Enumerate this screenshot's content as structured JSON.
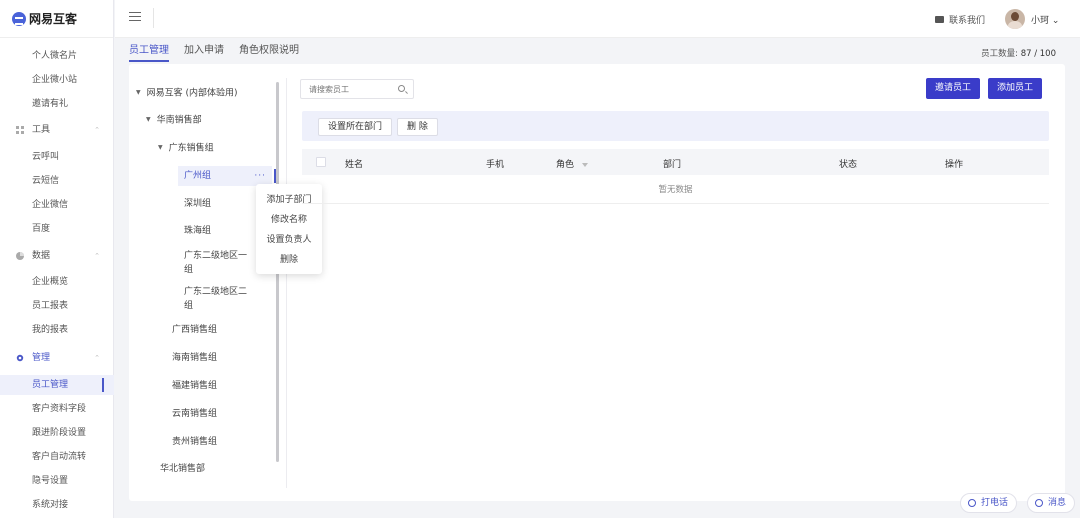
{
  "app": {
    "name": "网易互客"
  },
  "sidebar": {
    "items_top": [
      "个人微名片",
      "企业微小站",
      "邀请有礼"
    ],
    "groups": [
      {
        "label": "工具",
        "items": [
          "云呼叫",
          "云短信",
          "企业微信",
          "百度"
        ]
      },
      {
        "label": "数据",
        "items": [
          "企业概览",
          "员工报表",
          "我的报表"
        ]
      },
      {
        "label": "管理",
        "items": [
          "员工管理",
          "客户资料字段",
          "跟进阶段设置",
          "客户自动流转",
          "隐号设置",
          "系统对接"
        ]
      }
    ]
  },
  "header": {
    "contact": "联系我们",
    "user": "小珂"
  },
  "tabs": [
    "员工管理",
    "加入申请",
    "角色权限说明"
  ],
  "employee_count": {
    "label": "员工数量:",
    "value": "87 / 100"
  },
  "tree": {
    "root": "网易互客 (内部体验用)",
    "region1": "华南销售部",
    "group1": "广东销售组",
    "subgroups": [
      "广州组",
      "深圳组",
      "珠海组",
      "广东二级地区一组",
      "广东二级地区二组"
    ],
    "groups": [
      "广西销售组",
      "海南销售组",
      "福建销售组",
      "云南销售组",
      "贵州销售组"
    ],
    "region2": "华北销售部"
  },
  "context_menu": [
    "添加子部门",
    "修改名称",
    "设置负责人",
    "删除"
  ],
  "search": {
    "placeholder": "请搜索员工"
  },
  "buttons": {
    "invite": "邀请员工",
    "add": "添加员工",
    "set_dept": "设置所在部门",
    "delete": "删 除"
  },
  "table": {
    "columns": [
      "姓名",
      "手机",
      "角色",
      "部门",
      "状态",
      "操作"
    ],
    "empty": "暂无数据"
  },
  "float": {
    "call": "打电话",
    "message": "消息"
  }
}
